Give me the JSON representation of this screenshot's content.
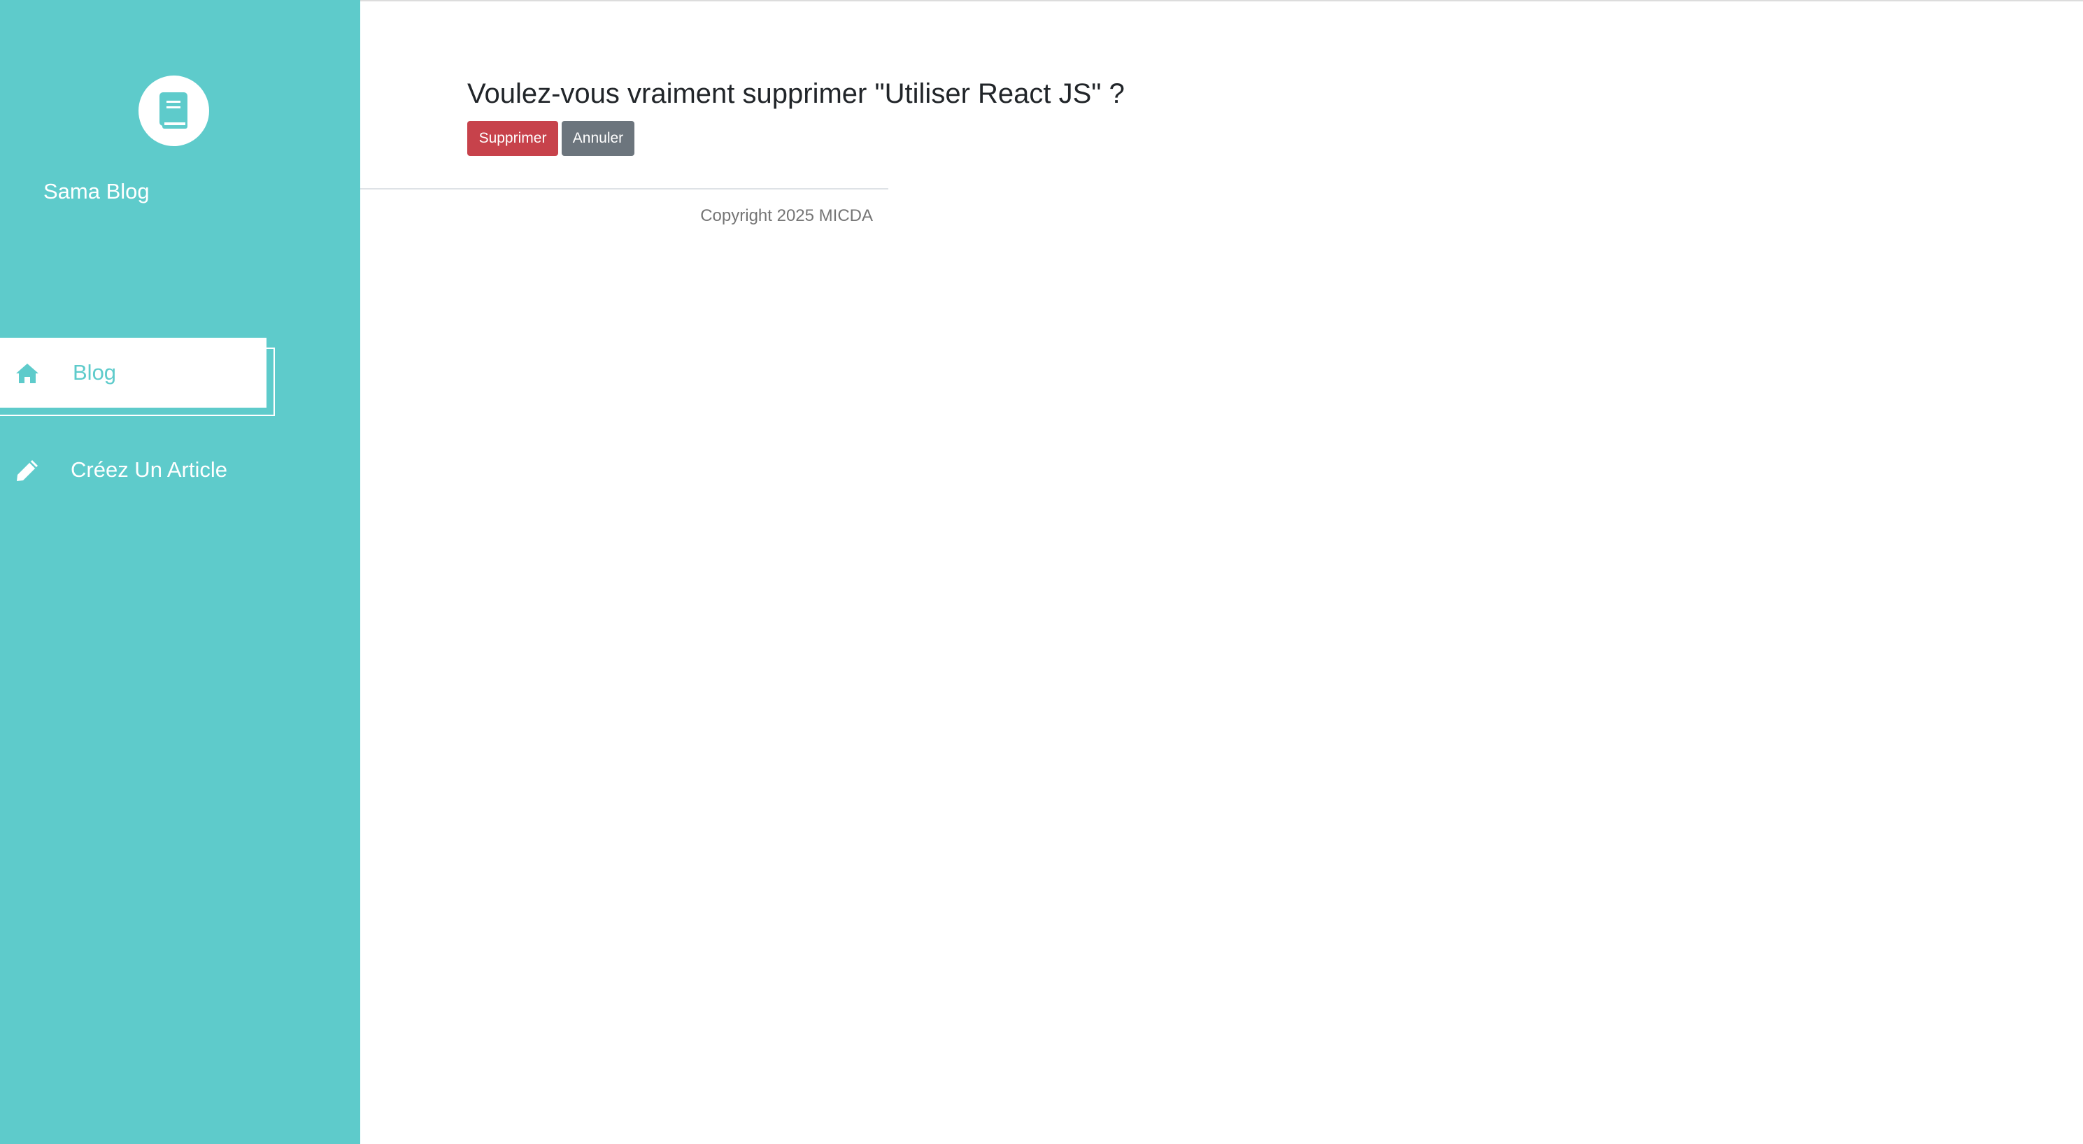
{
  "sidebar": {
    "brand": "Sama Blog",
    "logo_icon": "book-icon",
    "items": [
      {
        "label": "Blog",
        "icon": "home-icon",
        "active": true
      },
      {
        "label": "Créez Un Article",
        "icon": "pencil-icon",
        "active": false
      }
    ]
  },
  "main": {
    "title": "Voulez-vous vraiment supprimer \"Utiliser React JS\" ?",
    "delete_label": "Supprimer",
    "cancel_label": "Annuler"
  },
  "footer": {
    "copyright": "Copyright 2025 MICDA"
  },
  "colors": {
    "sidebar_bg": "#5ecbcb",
    "danger": "#c7424b",
    "secondary": "#6c757d"
  }
}
